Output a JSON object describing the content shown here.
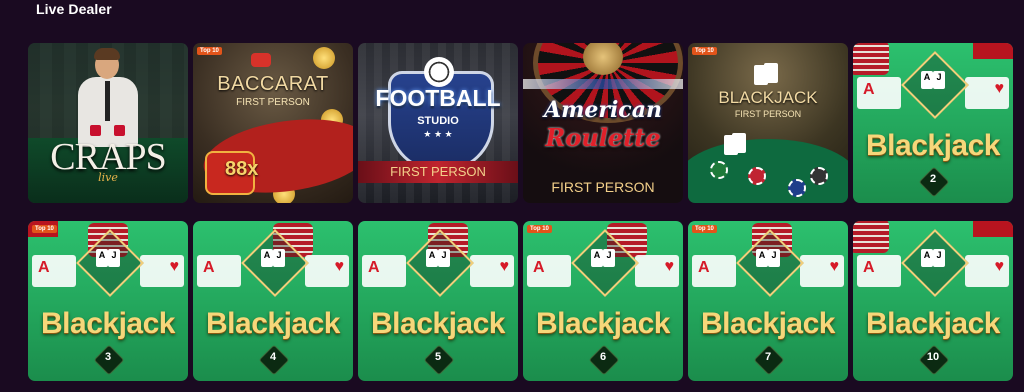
{
  "section": {
    "title": "Live Dealer"
  },
  "tiles": [
    {
      "game": "craps",
      "title": "CRAPS",
      "subtitle": "live"
    },
    {
      "game": "baccarat",
      "badge": "Top 10",
      "title": "BACCARAT",
      "subtitle": "FIRST PERSON",
      "multiplier": "88x"
    },
    {
      "game": "football-studio",
      "title": "FOOTBALL",
      "studio": "STUDIO",
      "stars": "★ ★ ★",
      "subtitle": "FIRST PERSON"
    },
    {
      "game": "american-roulette",
      "title_line1": "American",
      "title_line2": "Roulette",
      "subtitle": "FIRST PERSON"
    },
    {
      "game": "blackjack-first-person",
      "badge": "Top 10",
      "title": "BLACKJACK",
      "subtitle": "FIRST PERSON"
    },
    {
      "game": "blackjack-2",
      "title": "Blackjack",
      "number": "2"
    },
    {
      "game": "blackjack-3",
      "badge": "Top 10",
      "title": "Blackjack",
      "number": "3"
    },
    {
      "game": "blackjack-4",
      "title": "Blackjack",
      "number": "4"
    },
    {
      "game": "blackjack-5",
      "title": "Blackjack",
      "number": "5"
    },
    {
      "game": "blackjack-6",
      "badge": "Top 10",
      "title": "Blackjack",
      "number": "6"
    },
    {
      "game": "blackjack-7",
      "badge": "Top 10",
      "title": "Blackjack",
      "number": "7"
    },
    {
      "game": "blackjack-10",
      "title": "Blackjack",
      "number": "10"
    }
  ],
  "colors": {
    "background": "#1a0a21",
    "badge": "#e2541a",
    "blackjack_green": "#23a65c",
    "gold": "#f6d77a"
  }
}
